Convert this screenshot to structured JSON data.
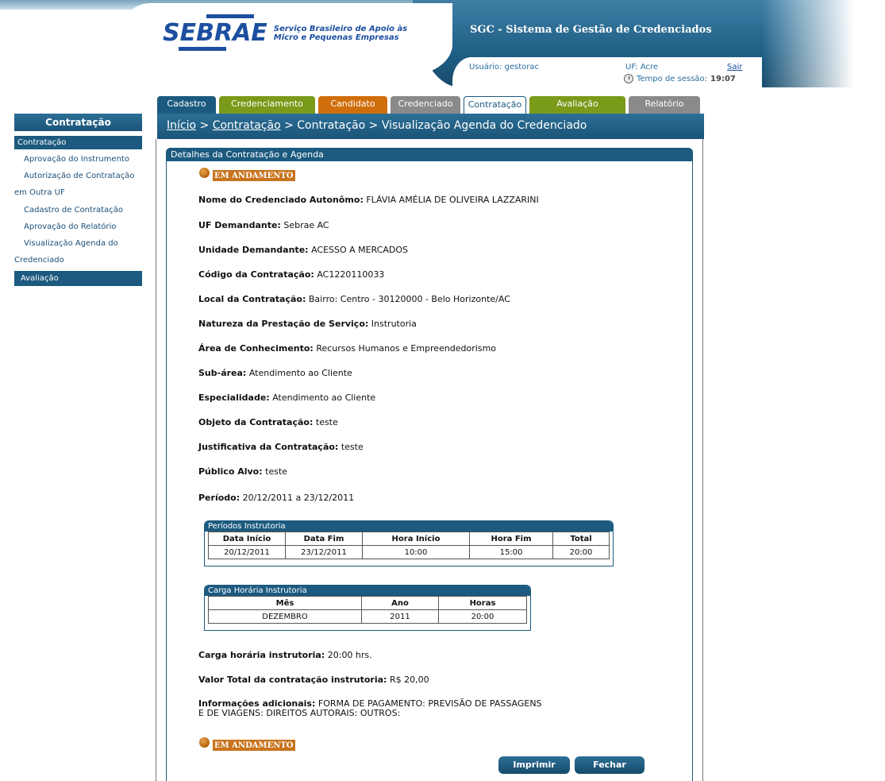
{
  "header": {
    "logo_text": "SEBRAE",
    "logo_subtitle": "Serviço Brasileiro de Apoio às Micro e Pequenas Empresas",
    "system_title": "SGC - Sistema de Gestão de Credenciados",
    "user_label": "Usuário: gestorac",
    "uf_label": "UF: Acre",
    "logout_label": "Sair",
    "session_label": "Tempo de sessão:",
    "session_time": "19:07"
  },
  "tabs": [
    {
      "label": "Cadastro",
      "color": "#1c5a7f"
    },
    {
      "label": "Credenciamento",
      "color": "#7a9a1a"
    },
    {
      "label": "Candidato",
      "color": "#d06e0b"
    },
    {
      "label": "Credenciado",
      "color": "#8a8a8a"
    },
    {
      "label": "Contratação",
      "color": "#ffffff",
      "active": true
    },
    {
      "label": "Avaliação",
      "color": "#7a9a1a"
    },
    {
      "label": "Relatório",
      "color": "#8a8a8a"
    }
  ],
  "breadcrumb": {
    "home": "Início",
    "sep1": " > ",
    "section": "Contratação",
    "rest": " > Contratação > Visualização Agenda do Credenciado"
  },
  "sidebar": {
    "title": "Contratação",
    "active_item": "Contratação",
    "items": [
      {
        "label": "Aprovação do Instrumento"
      },
      {
        "label": "Autorização de Contratação"
      },
      {
        "label": "em Outra UF"
      },
      {
        "label": "Cadastro de Contratação"
      },
      {
        "label": "Aprovação do Relatório"
      },
      {
        "label": "Visualização Agenda do"
      },
      {
        "label": "Credenciado"
      }
    ],
    "bottom_item": "Avaliação"
  },
  "panel": {
    "title": "Detalhes da Contratação e Agenda",
    "status": "EM ANDAMENTO",
    "fields": [
      {
        "label": "Nome do Credenciado Autonômo:",
        "value": "FLÁVIA AMÉLIA DE OLIVEIRA LAZZARINI"
      },
      {
        "label": "UF Demandante:",
        "value": "Sebrae AC"
      },
      {
        "label": "Unidade Demandante:",
        "value": "ACESSO A MERCADOS"
      },
      {
        "label": "Código da Contratação:",
        "value": "AC1220110033"
      },
      {
        "label": "Local da Contratação:",
        "value": "Bairro: Centro - 30120000 - Belo Horizonte/AC"
      },
      {
        "label": "Natureza da Prestação de Serviço:",
        "value": "Instrutoria"
      },
      {
        "label": "Área de Conhecimento:",
        "value": "Recursos Humanos e Empreendedorismo"
      },
      {
        "label": "Sub-área:",
        "value": "Atendimento ao Cliente"
      },
      {
        "label": "Especialidade:",
        "value": "Atendimento ao Cliente"
      },
      {
        "label": "Objeto da Contratação:",
        "value": "teste"
      },
      {
        "label": "Justificativa da Contratação:",
        "value": "teste"
      },
      {
        "label": "Público Alvo:",
        "value": "teste"
      },
      {
        "label": "Período:",
        "value": "20/12/2011 a 23/12/2011"
      }
    ],
    "periods_table": {
      "title": "Períodos Instrutoria",
      "headers": [
        "Data Início",
        "Data Fim",
        "Hora Início",
        "Hora Fim",
        "Total"
      ],
      "rows": [
        [
          "20/12/2011",
          "23/12/2011",
          "10:00",
          "15:00",
          "20:00"
        ]
      ]
    },
    "workload_table": {
      "title": "Carga Horária Instrutoria",
      "headers": [
        "Mês",
        "Ano",
        "Horas"
      ],
      "rows": [
        [
          "DEZEMBRO",
          "2011",
          "20:00"
        ]
      ]
    },
    "totals": [
      {
        "label": "Carga horária instrutoria:",
        "value": "20:00 hrs."
      },
      {
        "label": "Valor Total da contratação instrutoria:",
        "value": "R$ 20,00"
      }
    ],
    "additional_label": "Informações adicionais:",
    "additional_value": "FORMA DE PAGAMENTO: PREVISÃO DE PASSAGENS E DE VIAGENS: DIREITOS AUTORAIS: OUTROS:",
    "print_button": "Imprimir",
    "close_button": "Fechar"
  }
}
